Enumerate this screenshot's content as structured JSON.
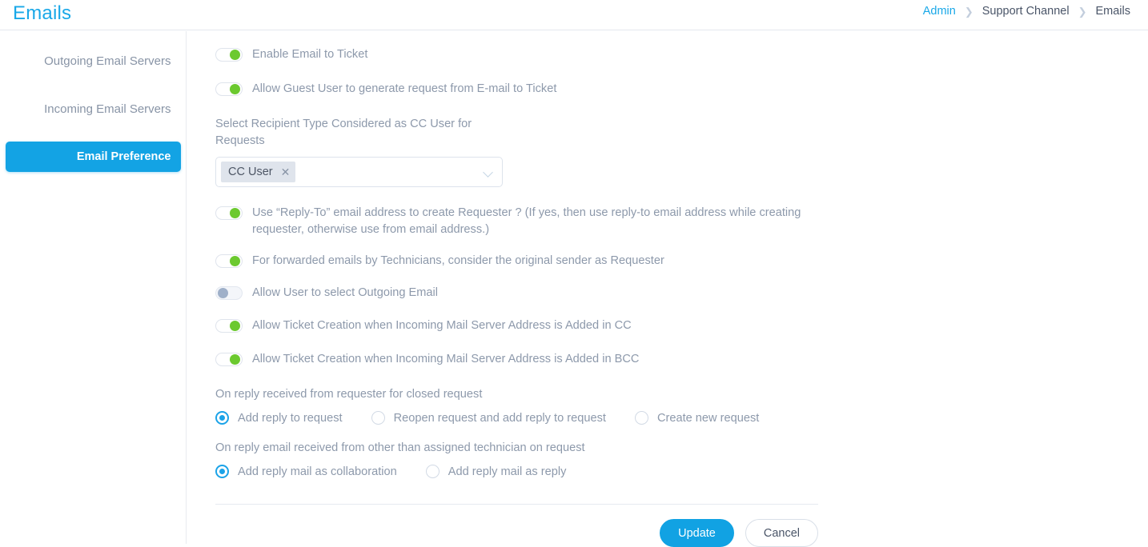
{
  "header": {
    "title": "Emails",
    "breadcrumb": [
      {
        "label": "Admin",
        "link": true
      },
      {
        "label": "Support Channel",
        "link": false
      },
      {
        "label": "Emails",
        "link": false
      }
    ],
    "separator_icon": "chevron-right-icon",
    "accent_color": "#19a8e8"
  },
  "sidebar": {
    "items": [
      {
        "label": "Outgoing Email Servers",
        "active": false
      },
      {
        "label": "Incoming Email Servers",
        "active": false
      },
      {
        "label": "Email Preference",
        "active": true
      }
    ],
    "active_bg": "#13a3e4"
  },
  "main": {
    "toggles": [
      {
        "label": "Enable Email to Ticket",
        "state": "on"
      },
      {
        "label": "Allow Guest User to generate request from E-mail to Ticket",
        "state": "on"
      }
    ],
    "recipient_field": {
      "label": "Select Recipient Type Considered as CC User for Requests",
      "tags": [
        {
          "label": "CC User",
          "remove_icon": "close-icon"
        }
      ],
      "dropdown_icon": "chevron-down-icon"
    },
    "toggles2": [
      {
        "label": "Use “Reply-To” email address to create Requester ? (If yes, then use reply-to email address while creating requester, otherwise use from email address.)",
        "state": "on"
      },
      {
        "label": "For forwarded emails by Technicians, consider the original sender as Requester",
        "state": "on"
      },
      {
        "label": "Allow User to select Outgoing Email",
        "state": "off"
      },
      {
        "label": "Allow Ticket Creation when Incoming Mail Server Address is Added in CC",
        "state": "on"
      },
      {
        "label": "Allow Ticket Creation when Incoming Mail Server Address is Added in BCC",
        "state": "on"
      }
    ],
    "radio_groups": [
      {
        "label": "On reply received from requester for closed request",
        "options": [
          {
            "label": "Add reply to request",
            "checked": true
          },
          {
            "label": "Reopen request and add reply to request",
            "checked": false
          },
          {
            "label": "Create new request",
            "checked": false
          }
        ]
      },
      {
        "label": "On reply email received from other than assigned technician on request",
        "options": [
          {
            "label": "Add reply mail as collaboration",
            "checked": true
          },
          {
            "label": "Add reply mail as reply",
            "checked": false
          }
        ]
      }
    ],
    "actions": {
      "update_label": "Update",
      "cancel_label": "Cancel",
      "primary_color": "#11a2e3"
    }
  },
  "colors": {
    "toggle_on": "#6cc92f",
    "toggle_off_knob": "#9fb0c9",
    "radio_checked": "#1ba3e8",
    "text": "#8d99ab"
  }
}
